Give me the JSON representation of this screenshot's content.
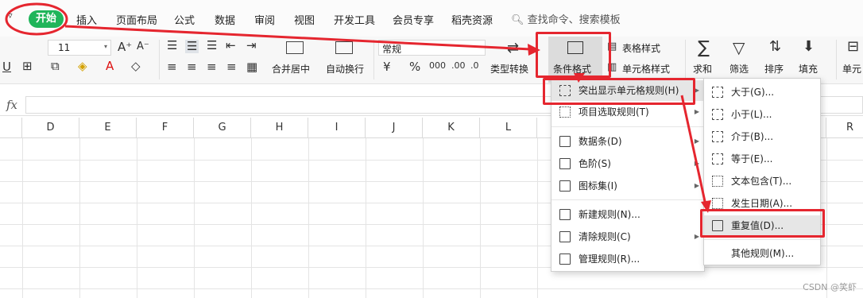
{
  "menu_tabs": {
    "start": "开始",
    "insert": "插入",
    "page_layout": "页面布局",
    "formula": "公式",
    "data": "数据",
    "review": "审阅",
    "view": "视图",
    "dev_tools": "开发工具",
    "member": "会员专享",
    "docer": "稻壳资源",
    "search": "查找命令、搜索模板"
  },
  "ribbon": {
    "font_size": "11",
    "number_format": "常规",
    "merge_center": "合并居中",
    "wrap_text": "自动换行",
    "type_convert": "类型转换",
    "conditional_format": "条件格式",
    "table_style": "表格样式",
    "cell_style": "单元格样式",
    "sum": "求和",
    "filter": "筛选",
    "sort": "排序",
    "fill": "填充",
    "cell_partial": "单元",
    "currency": "¥",
    "percent": "%"
  },
  "formula_bar": {
    "fx": "fx",
    "value": ""
  },
  "columns": [
    "D",
    "E",
    "F",
    "G",
    "H",
    "I",
    "J",
    "K",
    "L",
    "R"
  ],
  "cond_menu": {
    "highlight_rules": "突出显示单元格规则(H)",
    "top_bottom_rules": "项目选取规则(T)",
    "data_bars": "数据条(D)",
    "color_scales": "色阶(S)",
    "icon_sets": "图标集(I)",
    "new_rule": "新建规则(N)...",
    "clear_rules": "清除规则(C)",
    "manage_rules": "管理规则(R)..."
  },
  "highlight_submenu": {
    "greater": "大于(G)...",
    "less": "小于(L)...",
    "between": "介于(B)...",
    "equal": "等于(E)...",
    "text_contains": "文本包含(T)...",
    "date_occurring": "发生日期(A)...",
    "duplicate": "重复值(D)...",
    "more_rules": "其他规则(M)..."
  },
  "watermark": "CSDN @笑虾",
  "colors": {
    "accent_green": "#1fb55a",
    "annotation_red": "#e5262f",
    "highlight_gray": "#e6e6e6"
  }
}
